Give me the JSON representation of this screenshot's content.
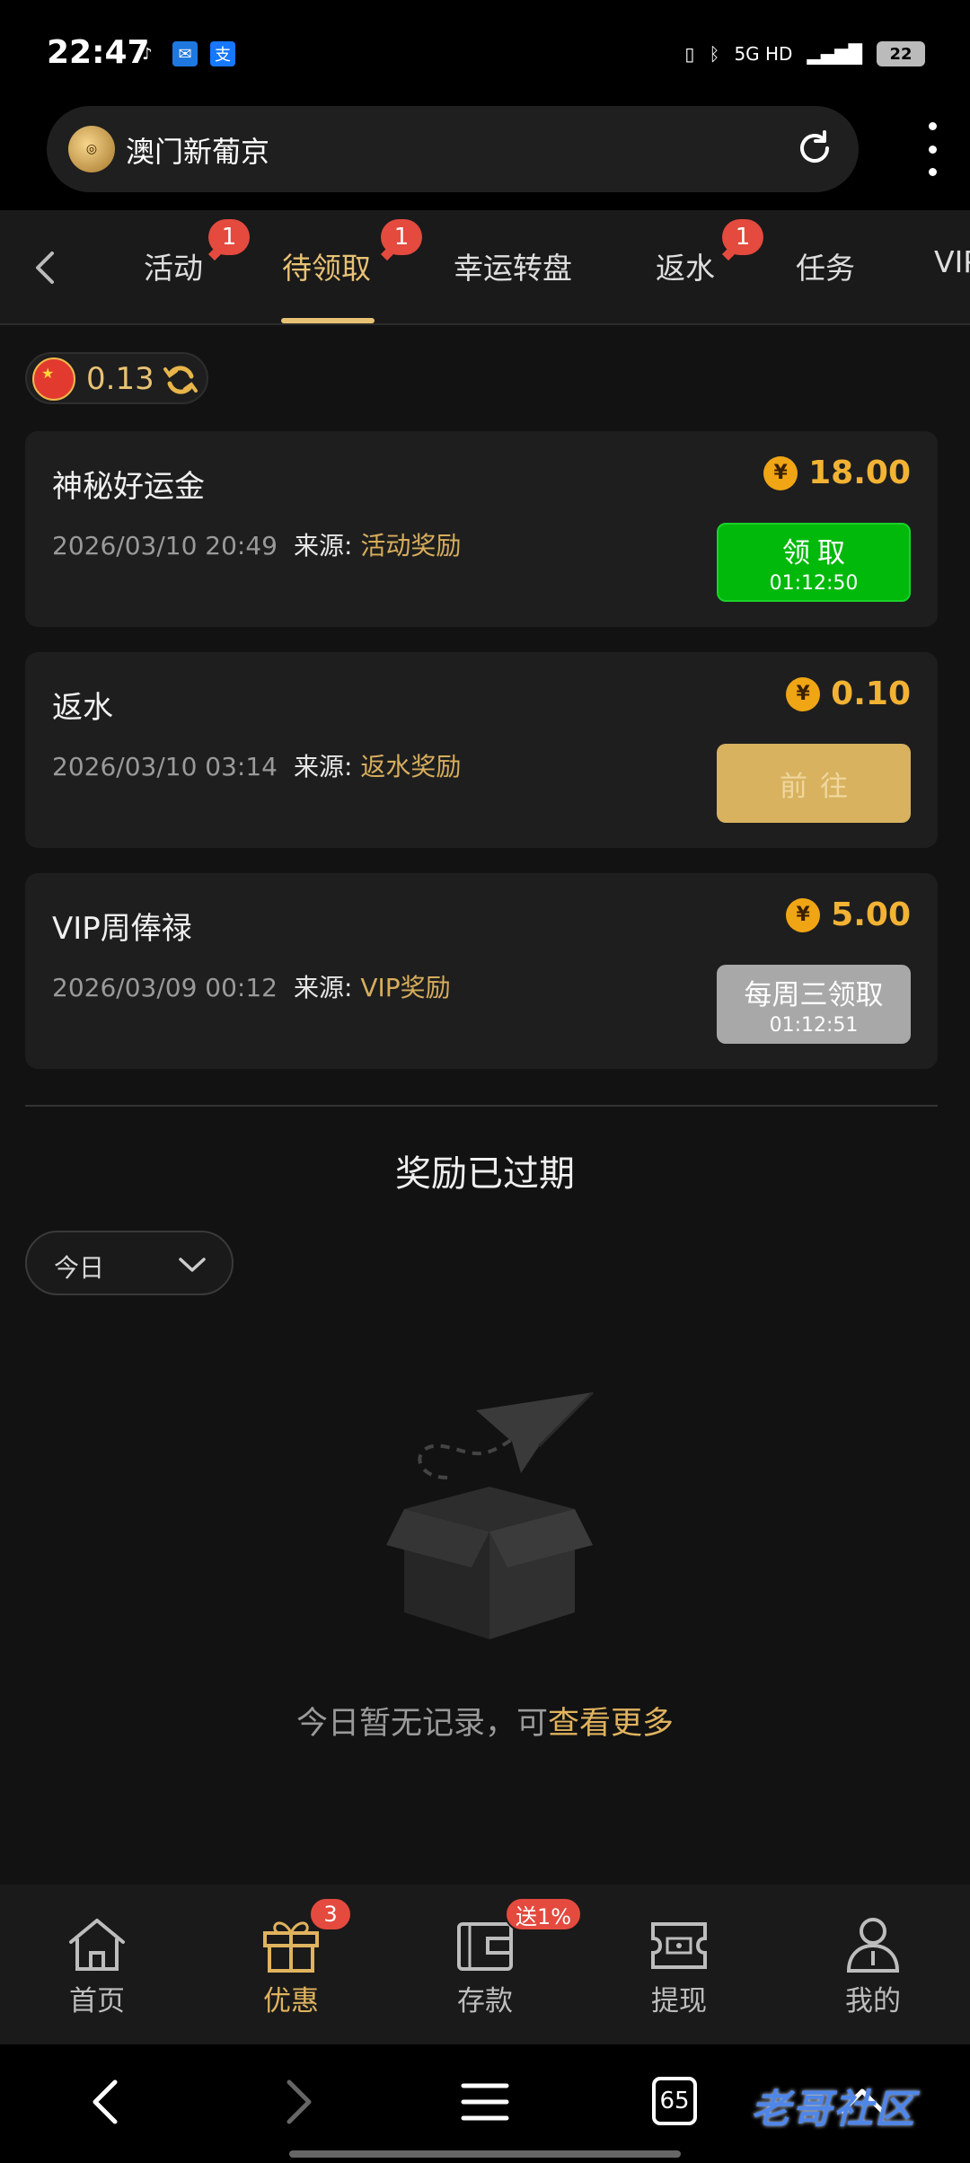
{
  "status_bar": {
    "time": "22:47",
    "network": "5G HD",
    "battery": "22"
  },
  "browser": {
    "site_title": "澳门新葡京",
    "logo_text": "澳门新葡京"
  },
  "tabs": [
    {
      "label": "活动",
      "badge": "1"
    },
    {
      "label": "待领取",
      "badge": "1",
      "active": true
    },
    {
      "label": "幸运转盘"
    },
    {
      "label": "返水",
      "badge": "1"
    },
    {
      "label": "任务"
    },
    {
      "label": "VIP"
    }
  ],
  "balance": {
    "value": "0.13"
  },
  "rewards": [
    {
      "title": "神秘好运金",
      "date": "2026/03/10 20:49",
      "source_label": "来源:",
      "source": "活动奖励",
      "amount": "18.00",
      "button": "领取",
      "timer": "01:12:50",
      "state": "claim"
    },
    {
      "title": "返水",
      "date": "2026/03/10 03:14",
      "source_label": "来源:",
      "source": "返水奖励",
      "amount": "0.10",
      "button": "前往",
      "timer": "",
      "state": "goto"
    },
    {
      "title": "VIP周俸禄",
      "date": "2026/03/09 00:12",
      "source_label": "来源:",
      "source": "VIP奖励",
      "amount": "5.00",
      "button": "每周三领取",
      "timer": "01:12:51",
      "state": "wait"
    }
  ],
  "expired": {
    "title": "奖励已过期",
    "filter": "今日",
    "empty_text": "今日暂无记录，可",
    "more_link": "查看更多"
  },
  "bottom_nav": [
    {
      "label": "首页",
      "icon": "home-icon"
    },
    {
      "label": "优惠",
      "icon": "gift-icon",
      "badge": "3",
      "active": true
    },
    {
      "label": "存款",
      "icon": "wallet-icon",
      "badge": "送1%"
    },
    {
      "label": "提现",
      "icon": "cash-icon"
    },
    {
      "label": "我的",
      "icon": "profile-icon"
    }
  ],
  "system_nav": {
    "tab_count": "65",
    "watermark": "老哥社区"
  },
  "colors": {
    "accent_gold": "#e8c274",
    "claim_green": "#00b90b",
    "badge_red": "#e44a3e",
    "amount_orange": "#f2b233"
  }
}
